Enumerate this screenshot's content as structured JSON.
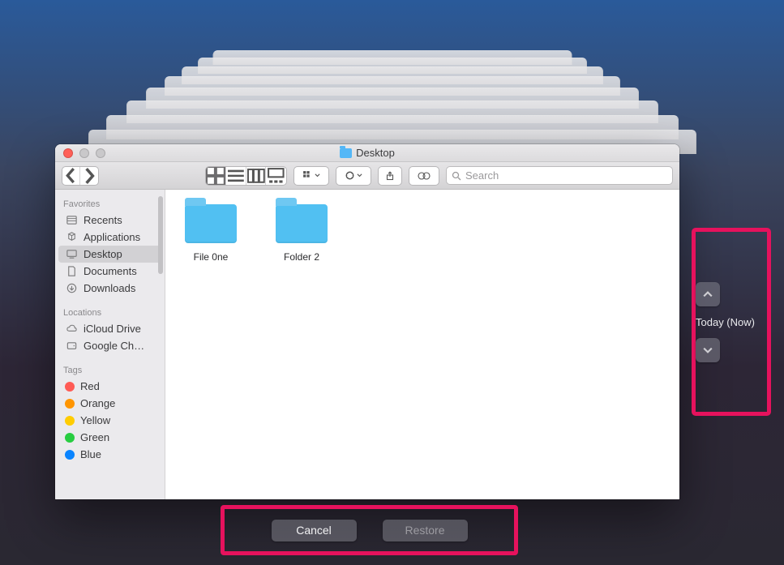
{
  "window": {
    "title": "Desktop"
  },
  "toolbar": {
    "search_placeholder": "Search"
  },
  "sidebar": {
    "sections": [
      {
        "label": "Favorites",
        "items": [
          {
            "label": "Recents",
            "icon": "recents"
          },
          {
            "label": "Applications",
            "icon": "applications"
          },
          {
            "label": "Desktop",
            "icon": "desktop",
            "selected": true
          },
          {
            "label": "Documents",
            "icon": "documents"
          },
          {
            "label": "Downloads",
            "icon": "downloads"
          }
        ]
      },
      {
        "label": "Locations",
        "items": [
          {
            "label": "iCloud Drive",
            "icon": "icloud"
          },
          {
            "label": "Google Ch…",
            "icon": "disk"
          }
        ]
      },
      {
        "label": "Tags",
        "items": [
          {
            "label": "Red",
            "color": "#ff5b55"
          },
          {
            "label": "Orange",
            "color": "#ff9500"
          },
          {
            "label": "Yellow",
            "color": "#ffcc00"
          },
          {
            "label": "Green",
            "color": "#28cd41"
          },
          {
            "label": "Blue",
            "color": "#0a84ff"
          }
        ]
      }
    ]
  },
  "content": {
    "items": [
      {
        "label": "File 0ne"
      },
      {
        "label": "Folder 2"
      }
    ]
  },
  "buttons": {
    "cancel": "Cancel",
    "restore": "Restore"
  },
  "timeline": {
    "label": "Today (Now)"
  }
}
